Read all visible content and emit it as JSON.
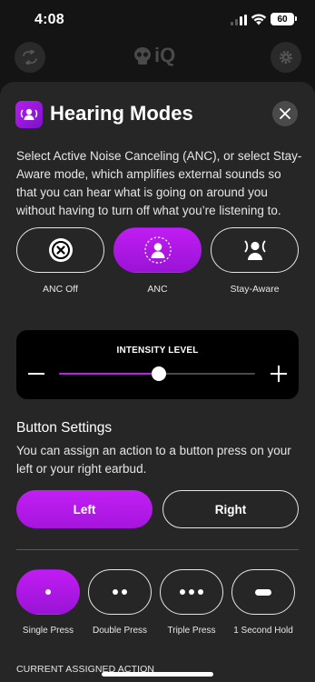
{
  "status_bar": {
    "time": "4:08",
    "battery": "60"
  },
  "app_header": {
    "logo_text": "iQ"
  },
  "sheet": {
    "title": "Hearing Modes",
    "description": "Select Active Noise Canceling (ANC), or select Stay-Aware mode, which amplifies external sounds so that you can hear what is going on around you without having to turn off what you’re listening to.",
    "modes": [
      {
        "label": "ANC Off",
        "icon": "anc-off-icon",
        "active": false
      },
      {
        "label": "ANC",
        "icon": "anc-icon",
        "active": true
      },
      {
        "label": "Stay-Aware",
        "icon": "stay-aware-icon",
        "active": false
      }
    ],
    "intensity": {
      "title": "INTENSITY LEVEL",
      "level_fraction": 0.51
    },
    "button_settings": {
      "title": "Button Settings",
      "description": "You can assign an action to a button press on your left or your right earbud.",
      "left_label": "Left",
      "right_label": "Right",
      "selected_side": "Left"
    },
    "press_types": [
      {
        "label": "Single Press",
        "dots": 1,
        "active": true
      },
      {
        "label": "Double Press",
        "dots": 2,
        "active": false
      },
      {
        "label": "Triple Press",
        "dots": 3,
        "active": false
      },
      {
        "label": "1 Second Hold",
        "dots": 0,
        "active": false
      }
    ],
    "current_action_label": "CURRENT ASSIGNED ACTION"
  },
  "colors": {
    "accent": "#c01df2",
    "background": "#141414",
    "sheet": "#262626"
  }
}
